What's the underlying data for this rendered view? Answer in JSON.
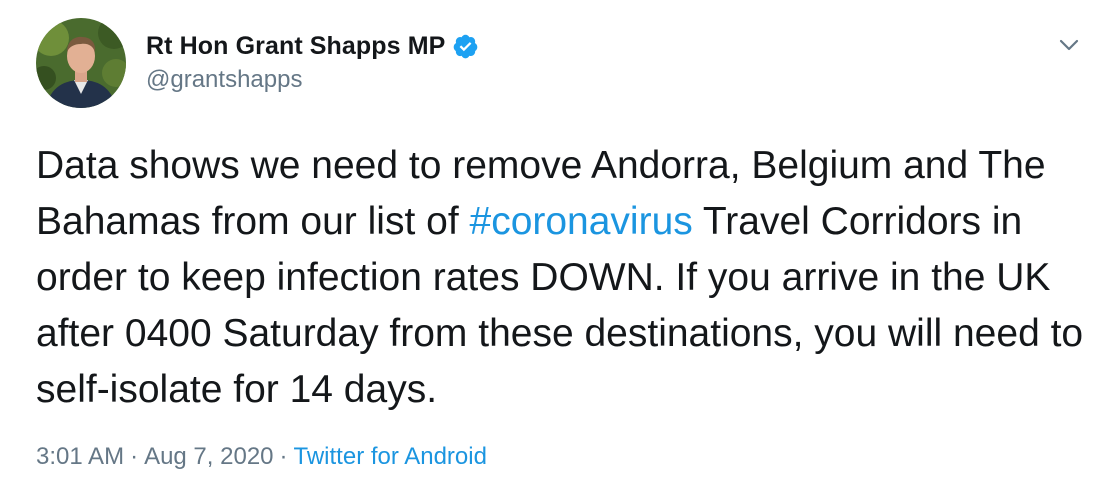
{
  "author": {
    "display_name": "Rt Hon Grant Shapps MP",
    "handle": "@grantshapps",
    "verified": true,
    "avatar_icon": "profile-photo",
    "verified_icon": "verified-badge-icon"
  },
  "menu": {
    "icon": "chevron-down-icon"
  },
  "tweet": {
    "text_part1": "Data shows we need to remove Andorra, Belgium and The Bahamas from our list of ",
    "hashtag": "#coronavirus",
    "text_part2": " Travel Corridors in order to keep infection rates DOWN. If you arrive in the UK after 0400 Saturday from these destinations, you will need to self-isolate for 14 days."
  },
  "meta": {
    "time": "3:01 AM",
    "separator": "·",
    "date": "Aug 7, 2020",
    "source": "Twitter for Android"
  },
  "colors": {
    "text": "#14171a",
    "secondary": "#657786",
    "link": "#1b95e0",
    "verified": "#1da1f2",
    "background": "#ffffff"
  }
}
